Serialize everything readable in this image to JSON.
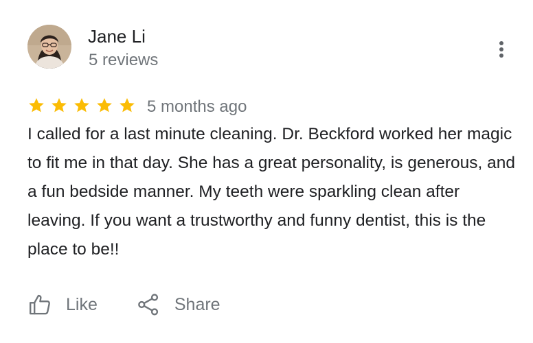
{
  "review": {
    "author": {
      "name": "Jane Li",
      "reviews_count": "5 reviews",
      "avatar_icon": "profile-photo"
    },
    "rating": 5,
    "rating_max": 5,
    "date": "5 months ago",
    "text": "I called for a last minute cleaning. Dr. Beckford worked her magic to fit me in that day. She has a great personality, is generous, and a fun bedside manner. My teeth were sparkling clean after leaving. If you want a trustworthy and funny dentist, this is the place to be!!",
    "more_icon": "more-vertical-icon"
  },
  "actions": {
    "like_label": "Like",
    "like_icon": "thumbs-up-icon",
    "share_label": "Share",
    "share_icon": "share-icon"
  },
  "colors": {
    "star": "#fbbc04",
    "text_primary": "#202124",
    "text_secondary": "#70757a",
    "icon_gray": "#5f6368"
  }
}
